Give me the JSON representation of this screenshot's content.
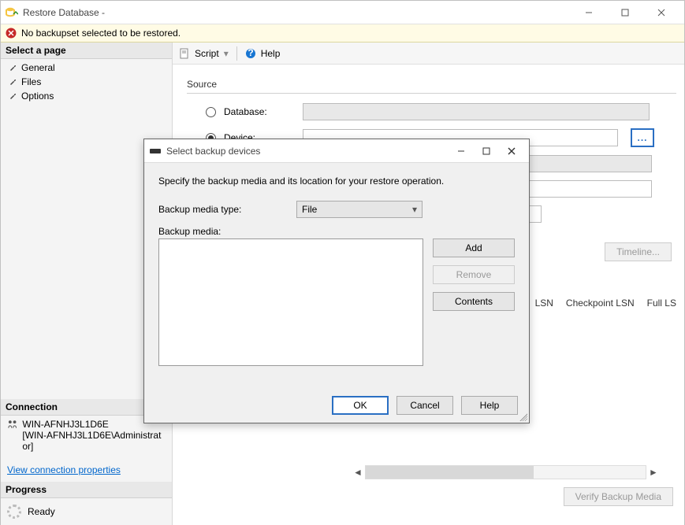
{
  "mainWindow": {
    "title": "Restore Database -",
    "warning": "No backupset selected to be restored."
  },
  "leftPanel": {
    "selectPageHeader": "Select a page",
    "pages": [
      "General",
      "Files",
      "Options"
    ],
    "connectionHeader": "Connection",
    "server": "WIN-AFNHJ3L1D6E",
    "login": "[WIN-AFNHJ3L1D6E\\Administrator]",
    "viewConnLink": "View connection properties",
    "progressHeader": "Progress",
    "progressText": "Ready"
  },
  "toolbar": {
    "script": "Script",
    "help": "Help"
  },
  "source": {
    "header": "Source",
    "databaseLabel": "Database:",
    "deviceLabel": "Device:"
  },
  "buttons": {
    "timeline": "Timeline...",
    "verify": "Verify Backup Media"
  },
  "columns": {
    "lsn": "LSN",
    "checkpoint": "Checkpoint LSN",
    "full": "Full LS"
  },
  "modal": {
    "title": "Select backup devices",
    "instruction": "Specify the backup media and its location for your restore operation.",
    "mediaTypeLabel": "Backup media type:",
    "mediaTypeValue": "File",
    "mediaLabel": "Backup media:",
    "add": "Add",
    "remove": "Remove",
    "contents": "Contents",
    "ok": "OK",
    "cancel": "Cancel",
    "help": "Help"
  }
}
